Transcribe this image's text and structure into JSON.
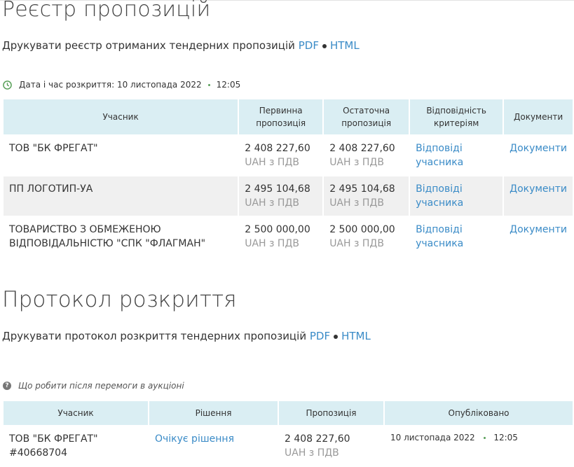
{
  "registry": {
    "title": "Реєстр пропозицій",
    "print_text": "Друкувати реєстр отриманих тендерних пропозицій",
    "pdf": "PDF",
    "html": "HTML",
    "opening_label": "Дата і час розкриття: 10 листопада 2022",
    "opening_time": "12:05",
    "headers": [
      "Учасник",
      "Первинна пропозиція",
      "Остаточна пропозиція",
      "Відповідність критеріям",
      "Документи"
    ],
    "rows": [
      {
        "participant": "ТОВ \"БК ФРЕГАТ\"",
        "initial": "2 408 227,60",
        "final": "2 408 227,60",
        "currency": "UAH з ПДВ",
        "answers": "Відповіді учасника",
        "docs": "Документи"
      },
      {
        "participant": "ПП ЛОГОТИП-УА",
        "initial": "2 495 104,68",
        "final": "2 495 104,68",
        "currency": "UAH з ПДВ",
        "answers": "Відповіді учасника",
        "docs": "Документи"
      },
      {
        "participant": "ТОВАРИСТВО З ОБМЕЖЕНОЮ ВІДПОВІДАЛЬНІСТЮ \"СПК \"ФЛАГМАН\"",
        "initial": "2 500 000,00",
        "final": "2 500 000,00",
        "currency": "UAH з ПДВ",
        "answers": "Відповіді учасника",
        "docs": "Документи"
      }
    ]
  },
  "protocol": {
    "title": "Протокол розкриття",
    "print_text": "Друкувати протокол розкриття тендерних пропозицій",
    "pdf": "PDF",
    "html": "HTML",
    "help_text": "Що робити після перемоги в аукціоні",
    "headers": [
      "Учасник",
      "Рішення",
      "Пропозиція",
      "Опубліковано"
    ],
    "rows": [
      {
        "participant": "ТОВ \"БК ФРЕГАТ\"",
        "code": "#40668704",
        "decision": "Очікує рішення",
        "offer": "2 408 227,60",
        "currency": "UAH з ПДВ",
        "published_date": "10 листопада 2022",
        "published_time": "12:05"
      }
    ]
  }
}
